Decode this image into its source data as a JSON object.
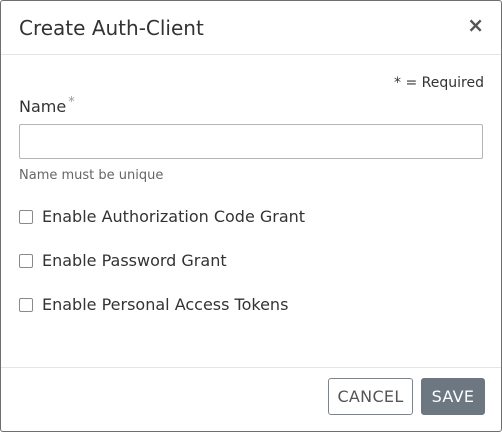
{
  "modal": {
    "title": "Create Auth-Client",
    "close_glyph": "×"
  },
  "form": {
    "required_note": "* = Required",
    "name_label": "Name",
    "required_star": "*",
    "name_value": "",
    "name_help": "Name must be unique"
  },
  "options": [
    {
      "label": "Enable Authorization Code Grant",
      "checked": false
    },
    {
      "label": "Enable Password Grant",
      "checked": false
    },
    {
      "label": "Enable Personal Access Tokens",
      "checked": false
    }
  ],
  "footer": {
    "cancel_label": "CANCEL",
    "save_label": "SAVE"
  },
  "colors": {
    "save_bg": "#6c7782",
    "border": "#6f6f6f"
  }
}
